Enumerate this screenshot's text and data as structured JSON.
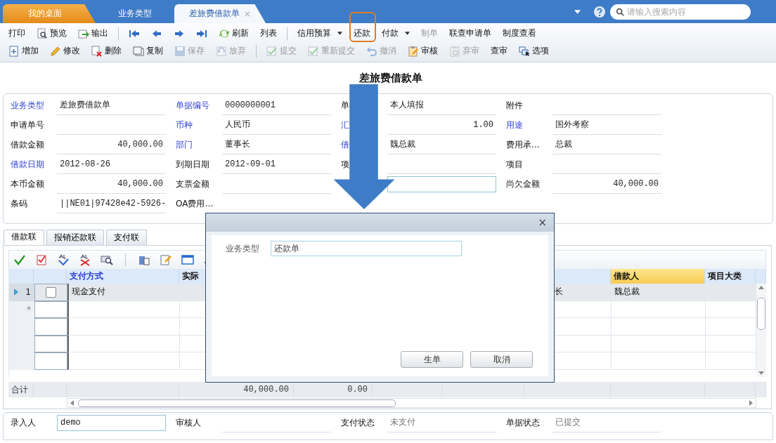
{
  "top_tabs": [
    {
      "label": "我的桌面",
      "kind": "home",
      "selected": false
    },
    {
      "label": "业务类型",
      "kind": "plain",
      "selected": false
    },
    {
      "label": "差旅费借款单",
      "kind": "document",
      "selected": true,
      "close": "×"
    }
  ],
  "search": {
    "placeholder": "请输入搜索内容"
  },
  "toolbar_rows": [
    [
      {
        "kind": "text",
        "label": "打印",
        "disabled": false
      },
      {
        "kind": "preview",
        "label": "预览",
        "disabled": false
      },
      {
        "kind": "export",
        "label": "输出",
        "disabled": false
      },
      {
        "kind": "separator"
      },
      {
        "kind": "first",
        "disabled": false
      },
      {
        "kind": "prev",
        "disabled": false
      },
      {
        "kind": "next",
        "disabled": false
      },
      {
        "kind": "last",
        "disabled": false
      },
      {
        "kind": "refresh",
        "label": "刷新",
        "disabled": false
      },
      {
        "kind": "text",
        "label": "列表",
        "disabled": false
      },
      {
        "kind": "separator"
      },
      {
        "kind": "menu",
        "label": "信用预算",
        "disabled": false
      },
      {
        "kind": "text",
        "label": "还款",
        "disabled": false
      },
      {
        "kind": "menu",
        "label": "付款",
        "disabled": false
      },
      {
        "kind": "text",
        "label": "制单",
        "disabled": true
      },
      {
        "kind": "text",
        "label": "联查申请单",
        "disabled": false
      },
      {
        "kind": "text",
        "label": "制度查看",
        "disabled": false
      }
    ],
    [
      {
        "kind": "add",
        "label": "增加",
        "disabled": false
      },
      {
        "kind": "edit",
        "label": "修改",
        "disabled": false
      },
      {
        "kind": "delete",
        "label": "删除",
        "disabled": false
      },
      {
        "kind": "copy",
        "label": "复制",
        "disabled": false
      },
      {
        "kind": "save",
        "label": "保存",
        "disabled": true
      },
      {
        "kind": "discard",
        "label": "放弃",
        "disabled": true
      },
      {
        "kind": "separator"
      },
      {
        "kind": "submit",
        "label": "提交",
        "disabled": true
      },
      {
        "kind": "submit",
        "label": "重新提交",
        "disabled": true
      },
      {
        "kind": "undo",
        "label": "撤消",
        "disabled": true
      },
      {
        "kind": "audit",
        "label": "审核",
        "disabled": false
      },
      {
        "kind": "unaudit",
        "label": "弃审",
        "disabled": true
      },
      {
        "kind": "text",
        "label": "查审",
        "disabled": false
      },
      {
        "kind": "options",
        "label": "选项",
        "disabled": false
      }
    ]
  ],
  "form": {
    "title": "差旅费借款单",
    "columns": [
      [
        {
          "label": "业务类型",
          "required": true,
          "value": "差旅费借款单",
          "kind": "text"
        },
        {
          "label": "申请单号",
          "required": false,
          "kind": "text"
        },
        {
          "label": "借款金额",
          "required": false,
          "value": "40,000.00",
          "kind": "amount"
        },
        {
          "label": "借款日期",
          "required": true,
          "value": "2012-08-26",
          "kind": "text"
        },
        {
          "label": "本币金额",
          "required": false,
          "value": "40,000.00",
          "kind": "amount"
        },
        {
          "label": "条码",
          "required": false,
          "value": "||NE01|97428e42-5926-",
          "kind": "text"
        }
      ],
      [
        {
          "label": "单据编号",
          "required": true,
          "value": "0000000001",
          "kind": "text"
        },
        {
          "label": "币种",
          "required": true,
          "value": "人民币",
          "kind": "text"
        },
        {
          "label": "部门",
          "required": true,
          "value": "董事长",
          "kind": "text"
        },
        {
          "label": "到期日期",
          "required": false,
          "value": "2012-09-01",
          "kind": "text"
        },
        {
          "label": "支票金额",
          "required": false,
          "kind": "text"
        },
        {
          "label": "OA费用…",
          "required": false,
          "kind": "text"
        }
      ],
      [
        {
          "label": "单",
          "required": false,
          "value": "本人填报",
          "kind": "text"
        },
        {
          "label": "汇",
          "required": true,
          "value": "1.00",
          "kind": "amount"
        },
        {
          "label": "借",
          "required": true,
          "value": "魏总裁",
          "kind": "text"
        },
        {
          "label": "项",
          "required": false,
          "kind": "text"
        },
        {
          "kind": "input"
        }
      ],
      [
        {
          "label": "附件",
          "required": false,
          "kind": "text"
        },
        {
          "label": "用途",
          "required": true,
          "value": "国外考察",
          "kind": "text"
        },
        {
          "label": "费用承…",
          "required": false,
          "value": "总裁",
          "kind": "text"
        },
        {
          "label": "项目",
          "required": false,
          "kind": "text"
        },
        {
          "label": "尚欠金额",
          "required": false,
          "value": "40,000.00",
          "kind": "amount"
        }
      ]
    ]
  },
  "detail_tabs": [
    {
      "label": "借款联",
      "selected": true
    },
    {
      "label": "报销还款联",
      "selected": false
    },
    {
      "label": "支付联",
      "selected": false
    }
  ],
  "grid": {
    "toolbar": [
      {
        "kind": "check"
      },
      {
        "kind": "checklist"
      },
      {
        "kind": "select-all"
      },
      {
        "kind": "deselect-all"
      },
      {
        "kind": "find"
      },
      {
        "kind": "separator"
      },
      {
        "kind": "paste"
      },
      {
        "kind": "edit"
      },
      {
        "kind": "window"
      },
      {
        "kind": "eraser"
      }
    ],
    "columns": [
      {
        "label": "支付方式",
        "required": true,
        "selected": false
      },
      {
        "label": "实际",
        "required": false,
        "selected": false
      },
      {},
      {},
      {},
      {
        "selected": false
      },
      {
        "label": "借款人",
        "required": false,
        "selected": true
      },
      {
        "label": "项目大类",
        "required": false,
        "selected": false
      }
    ],
    "rows": [
      {
        "kind": "data",
        "number": "1",
        "selected": true,
        "checked": false,
        "cells": [
          "现金支付",
          null,
          null,
          null,
          null,
          "长",
          "魏总裁",
          null
        ]
      },
      {
        "kind": "new",
        "marker": "*",
        "selected": false
      },
      {
        "kind": "blank",
        "selected": false
      },
      {
        "kind": "blank",
        "selected": false
      },
      {
        "kind": "blank",
        "selected": false
      }
    ],
    "totals": {
      "label": "合计",
      "cells": [
        null,
        "40,000.00",
        "0.00",
        null,
        null,
        null,
        null,
        null
      ]
    }
  },
  "footer": [
    {
      "label": "录入人",
      "value": "demo",
      "kind": "input"
    },
    {
      "label": "审核人",
      "kind": "text"
    },
    {
      "label": "支付状态",
      "value": "未支付",
      "kind": "status"
    },
    {
      "label": "单据状态",
      "value": "已提交",
      "kind": "status"
    }
  ],
  "dialog": {
    "close": "×",
    "fields": [
      {
        "label": "业务类型",
        "value": "还款单"
      }
    ],
    "buttons": [
      "生单",
      "取消"
    ]
  }
}
